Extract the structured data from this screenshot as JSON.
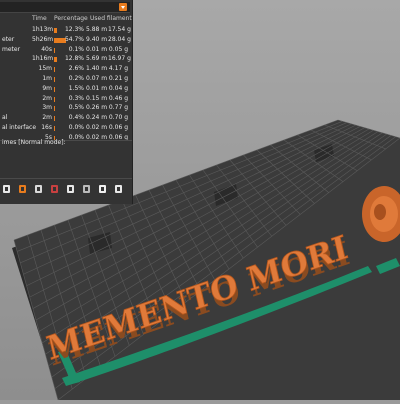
{
  "app": {
    "accent_color": "#e87c1e"
  },
  "columns": {
    "time": "Time",
    "percentage": "Percentage",
    "used": "Used filament"
  },
  "feature_rows": [
    {
      "name": "",
      "time": "1h13m",
      "pct": "12.3%",
      "pct_value": 12.3,
      "length": "5.88 m",
      "weight": "17.54 g"
    },
    {
      "name": "eter",
      "time": "5h26m",
      "pct": "54.7%",
      "pct_value": 54.7,
      "length": "9.40 m",
      "weight": "28.04 g"
    },
    {
      "name": "meter",
      "time": "40s",
      "pct": "0.1%",
      "pct_value": 0.1,
      "length": "0.01 m",
      "weight": "0.05 g"
    },
    {
      "name": "",
      "time": "1h16m",
      "pct": "12.8%",
      "pct_value": 12.8,
      "length": "5.69 m",
      "weight": "16.97 g"
    },
    {
      "name": "",
      "time": "15m",
      "pct": "2.6%",
      "pct_value": 2.6,
      "length": "1.40 m",
      "weight": "4.17 g"
    },
    {
      "name": "",
      "time": "1m",
      "pct": "0.2%",
      "pct_value": 0.2,
      "length": "0.07 m",
      "weight": "0.21 g"
    },
    {
      "name": "",
      "time": "9m",
      "pct": "1.5%",
      "pct_value": 1.5,
      "length": "0.01 m",
      "weight": "0.04 g"
    },
    {
      "name": "",
      "time": "2m",
      "pct": "0.3%",
      "pct_value": 0.3,
      "length": "0.15 m",
      "weight": "0.46 g"
    },
    {
      "name": "",
      "time": "3m",
      "pct": "0.5%",
      "pct_value": 0.5,
      "length": "0.26 m",
      "weight": "0.77 g"
    },
    {
      "name": "al",
      "time": "2m",
      "pct": "0.4%",
      "pct_value": 0.4,
      "length": "0.24 m",
      "weight": "0.70 g"
    },
    {
      "name": "al interface",
      "time": "16s",
      "pct": "0.0%",
      "pct_value": 0.0,
      "length": "0.02 m",
      "weight": "0.06 g"
    },
    {
      "name": "",
      "time": "5s",
      "pct": "0.0%",
      "pct_value": 0.0,
      "length": "0.02 m",
      "weight": "0.06 g"
    }
  ],
  "footer": {
    "times_label": "imes [Normal mode]:"
  },
  "toolbar_icons": [
    "layers-icon",
    "color-swatch-icon",
    "painting-icon",
    "paint-palette-icon",
    "hourglass-icon",
    "cube-view-icon",
    "checker-icon",
    "arrow-down-icon"
  ],
  "model": {
    "text": "MEMENTO MORI"
  }
}
